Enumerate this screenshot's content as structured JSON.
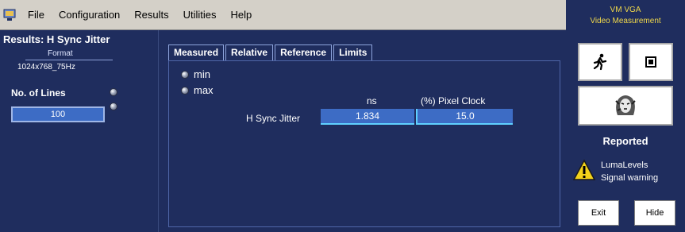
{
  "menu": {
    "items": [
      {
        "label": "File"
      },
      {
        "label": "Configuration"
      },
      {
        "label": "Results"
      },
      {
        "label": "Utilities"
      },
      {
        "label": "Help"
      }
    ]
  },
  "left": {
    "results_title": "Results: H Sync Jitter",
    "format_label": "Format",
    "format_value": "1024x768_75Hz",
    "lines_label": "No. of Lines",
    "lines_value": "100"
  },
  "tabs": [
    {
      "label": "Measured"
    },
    {
      "label": "Relative"
    },
    {
      "label": "Reference"
    },
    {
      "label": "Limits"
    }
  ],
  "options": {
    "min": "min",
    "max": "max",
    "selected": "max"
  },
  "table": {
    "col_ns": "ns",
    "col_pct": "(%) Pixel Clock",
    "row_label": "H Sync Jitter",
    "ns_value": "1.834",
    "pct_value": "15.0"
  },
  "right": {
    "app_title_line1": "VM VGA",
    "app_title_line2": "Video Measurement",
    "reported": "Reported",
    "warn_line1": "LumaLevels",
    "warn_line2": "Signal warning",
    "exit_label": "Exit",
    "hide_label": "Hide"
  },
  "colors": {
    "panel_bg": "#1f2d5e",
    "value_bg": "#3d6cc5",
    "accent_cyan": "#5fd0ff",
    "title_yellow": "#f0d84a"
  }
}
